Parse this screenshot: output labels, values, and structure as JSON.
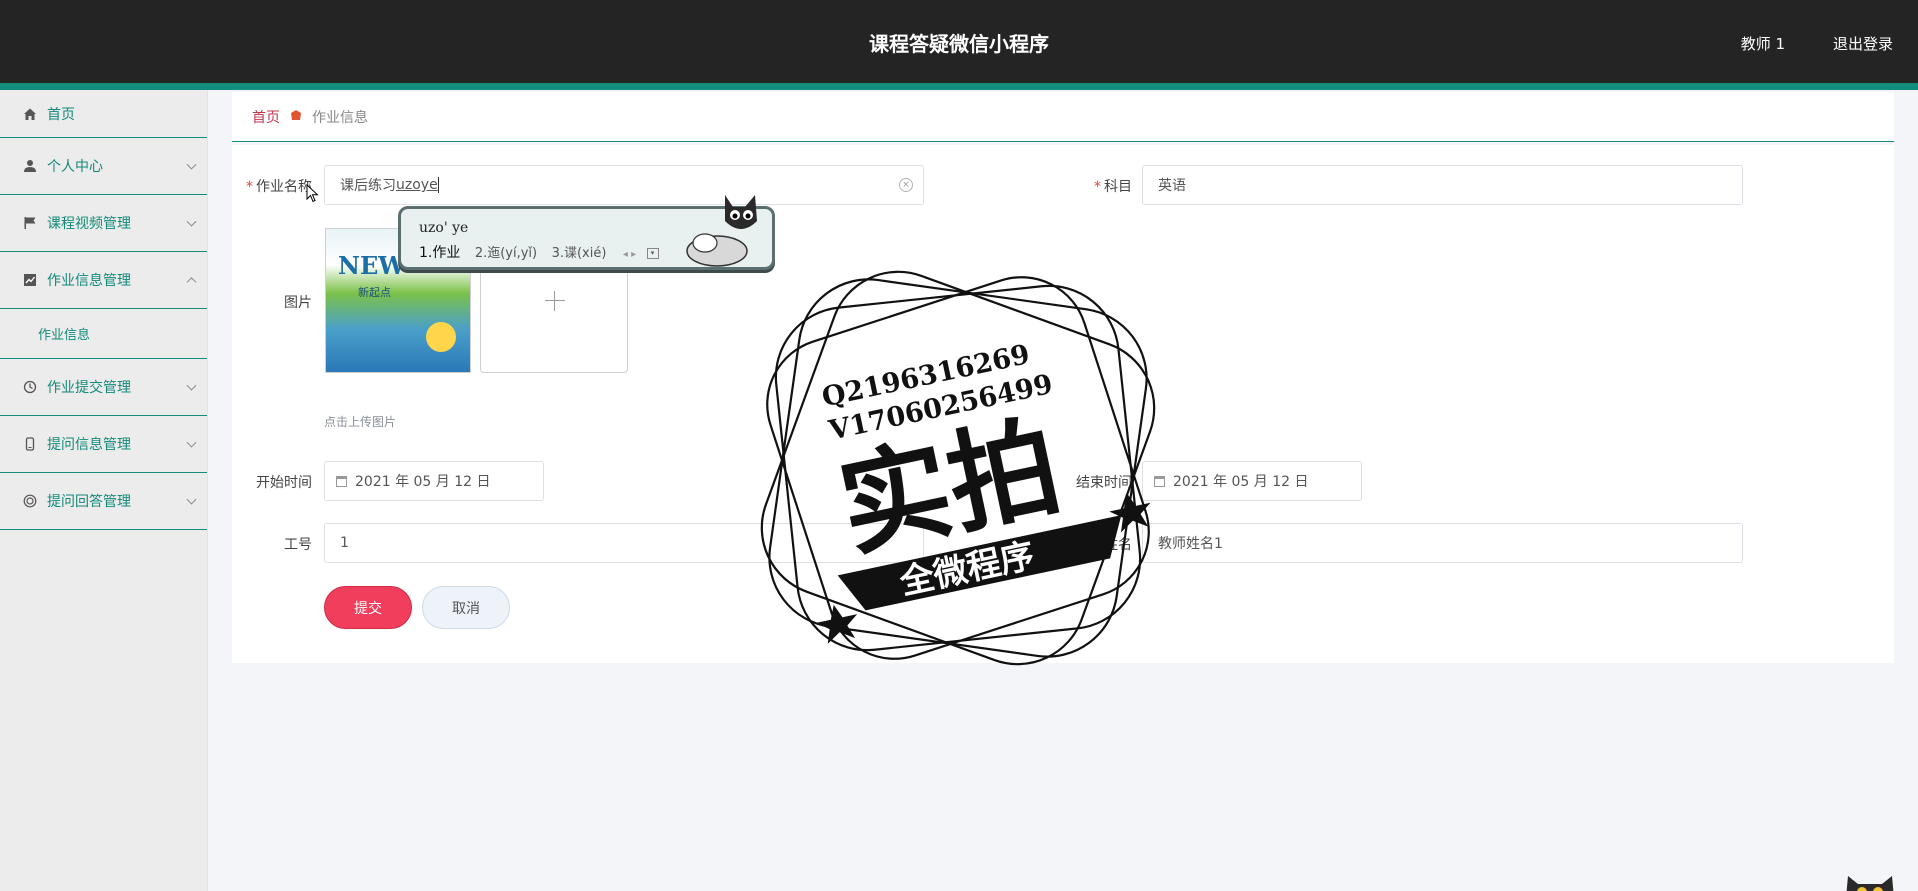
{
  "header": {
    "title": "课程答疑微信小程序",
    "user": "教师 1",
    "logout": "退出登录"
  },
  "sidebar": {
    "items": [
      {
        "label": "首页",
        "icon": "home-icon"
      },
      {
        "label": "个人中心",
        "icon": "user-icon"
      },
      {
        "label": "课程视频管理",
        "icon": "flag-icon"
      },
      {
        "label": "作业信息管理",
        "icon": "chart-icon",
        "expanded": true
      },
      {
        "label": "作业提交管理",
        "icon": "clock-icon"
      },
      {
        "label": "提问信息管理",
        "icon": "phone-icon"
      },
      {
        "label": "提问回答管理",
        "icon": "target-icon"
      }
    ],
    "sub_item": "作业信息"
  },
  "breadcrumb": {
    "home": "首页",
    "current": "作业信息"
  },
  "form": {
    "name_label": "作业名称",
    "name_prefix": "课后练习",
    "name_typing": "uzoye",
    "subject_label": "科目",
    "subject_value": "英语",
    "image_label": "图片",
    "upload_hint": "点击上传图片",
    "start_label": "开始时间",
    "start_value": "2021 年 05 月 12 日",
    "end_label": "结束时间",
    "end_value": "2021 年 05 月 12 日",
    "id_label": "工号",
    "id_value": "1",
    "teacher_label": "教师姓名",
    "teacher_value": "教师姓名1",
    "submit": "提交",
    "cancel": "取消"
  },
  "book_cover": {
    "title": "NEW",
    "subtitle": "新起点"
  },
  "ime": {
    "composition": "uzo' ye",
    "candidates": [
      "1.作业",
      "2.迤(yí,yǐ)",
      "3.谍(xié)"
    ]
  },
  "watermark": {
    "line1": "Q2196316269",
    "line2": "V17060256499",
    "big": "实拍",
    "banner": "全微程序"
  }
}
